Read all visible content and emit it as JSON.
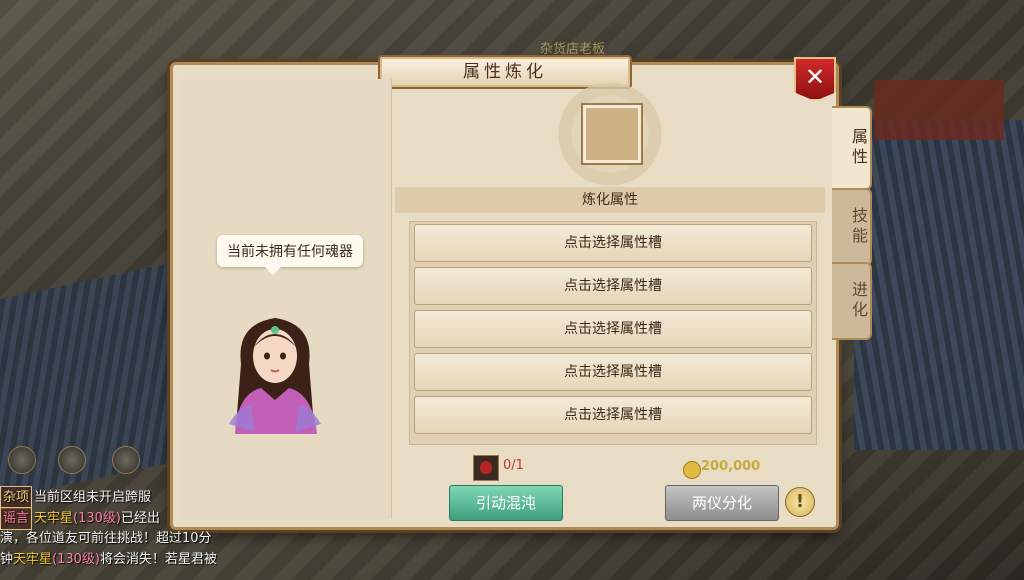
{
  "scene": {
    "shop_sign": "杂货店老板"
  },
  "panel": {
    "title": "属性炼化",
    "close_label": "✕",
    "speech": "当前未拥有任何魂器",
    "section_title": "炼化属性",
    "slots": [
      "点击选择属性槽",
      "点击选择属性槽",
      "点击选择属性槽",
      "点击选择属性槽",
      "点击选择属性槽"
    ],
    "requirement": "0/1",
    "cost": "200,000",
    "primary_button": "引动混沌",
    "secondary_button": "两仪分化",
    "info_label": "!"
  },
  "tabs": [
    {
      "label": "属性"
    },
    {
      "label": "技能"
    },
    {
      "label": "进化"
    }
  ],
  "chat": {
    "line1": {
      "tag": "杂项",
      "text": "当前区组未开启跨服"
    },
    "line2": {
      "tag": "谣言",
      "name": "天牢星",
      "level": "(130级)",
      "text": "已经出"
    },
    "line3": {
      "text": "演，各位道友可前往挑战！超过10分"
    },
    "line4": {
      "prefix": "钟",
      "name": "天牢星",
      "level": "(130级)",
      "text": "将会消失！若星君被"
    }
  },
  "colors": {
    "panel_bg": "#e9dcc4",
    "accent_gold": "#b08a55",
    "close_red": "#c41f1f",
    "primary_green": "#4fb48f",
    "secondary_gray": "#a9a9a9"
  }
}
